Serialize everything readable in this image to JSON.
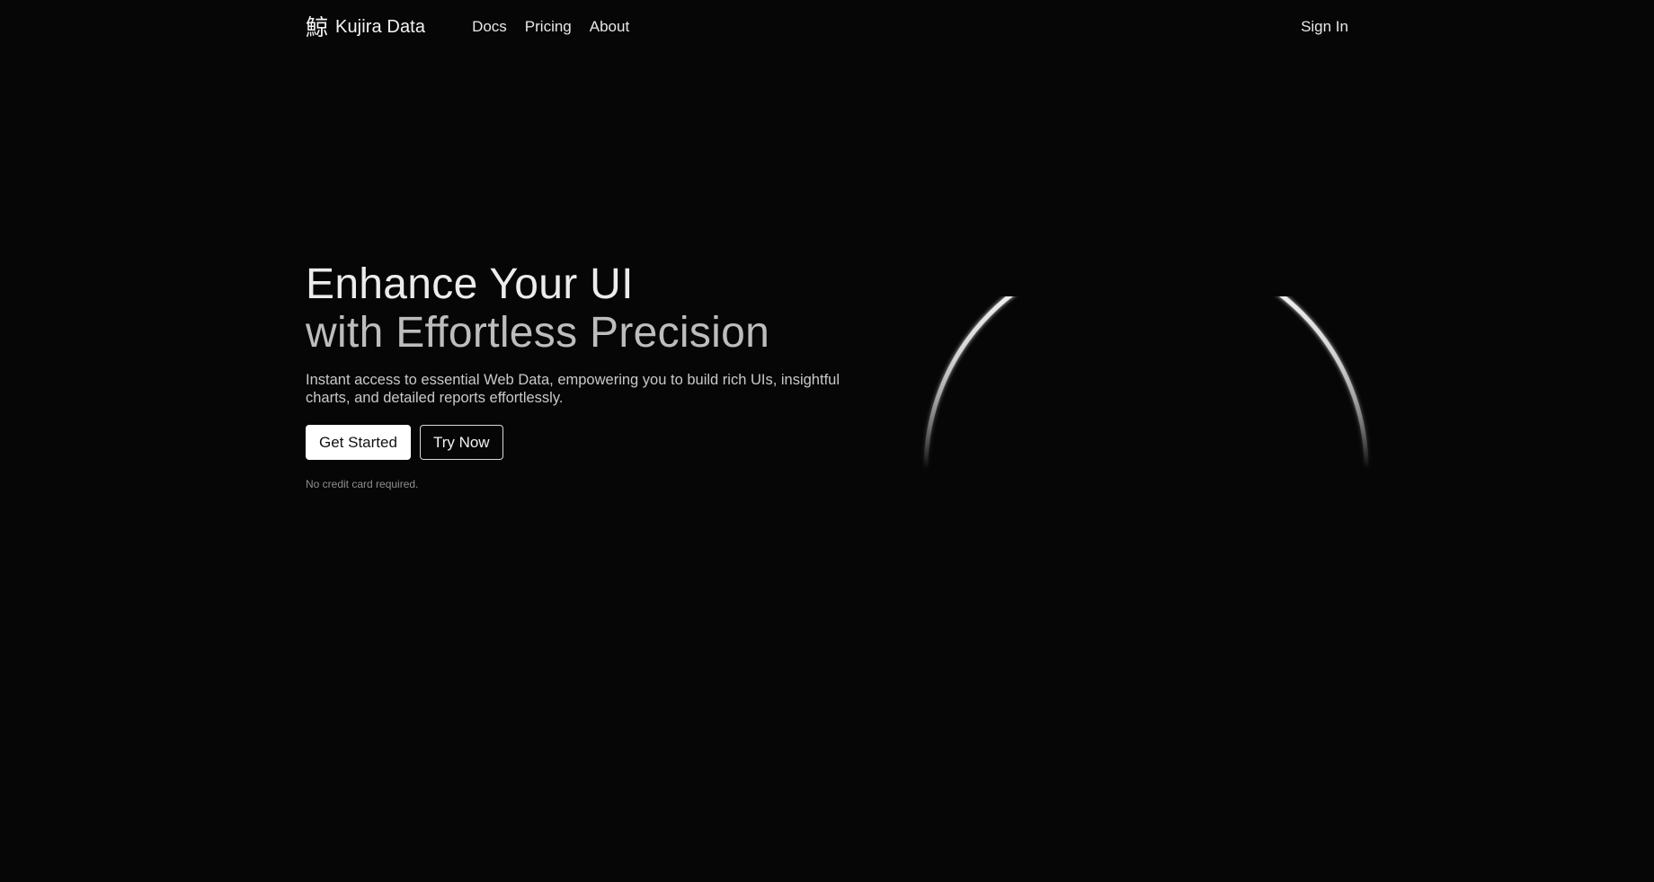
{
  "header": {
    "logo_glyph": "鯨",
    "brand_name": "Kujira Data",
    "nav": [
      {
        "label": "Docs"
      },
      {
        "label": "Pricing"
      },
      {
        "label": "About"
      }
    ],
    "sign_in_label": "Sign In"
  },
  "hero": {
    "headline_line1": "Enhance Your UI",
    "headline_line2": "with Effortless Precision",
    "subtext": "Instant access to essential Web Data, empowering you to build rich UIs, insightful charts, and detailed reports effortlessly.",
    "primary_button": "Get Started",
    "secondary_button": "Try Now",
    "note": "No credit card required."
  },
  "colors": {
    "background": "#060606",
    "text_primary": "#ececec",
    "text_secondary": "#bdbdbd",
    "button_primary_bg": "#ffffff",
    "arc_stroke": "#ffffff"
  }
}
